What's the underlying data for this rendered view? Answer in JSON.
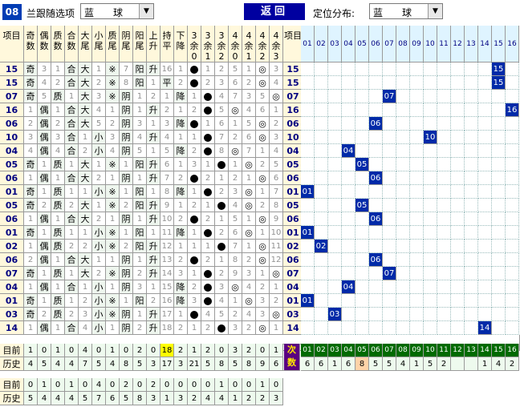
{
  "toolbar": {
    "badge": "08",
    "option_label": "兰跟随选项",
    "option_value": "蓝　　球",
    "return_label": "返回",
    "position_label": "定位分布:",
    "position_value": "蓝　　球"
  },
  "headers": [
    "项目",
    "奇数",
    "偶数",
    "质数",
    "合数",
    "大尾",
    "小尾",
    "质尾",
    "阴尾",
    "阳尾",
    "上升",
    "持平",
    "下降",
    "3余0",
    "3余1",
    "3余2",
    "4余0",
    "4余1",
    "4余2",
    "4余3",
    "项目"
  ],
  "nums": [
    "01",
    "02",
    "03",
    "04",
    "05",
    "06",
    "07",
    "08",
    "09",
    "10",
    "11",
    "12",
    "13",
    "14",
    "15",
    "16"
  ],
  "rows": [
    {
      "n": "15",
      "o": "奇",
      "e": "3",
      "p": "1",
      "h": "合",
      "b": "大",
      "s": "1",
      "pw": "※",
      "yi": "7",
      "ya": "阳",
      "u": "升",
      "f": "16",
      "d": "1",
      "m3": 0,
      "c3": [
        "1",
        "2"
      ],
      "m4": 2,
      "c4": [
        "5",
        "1",
        "3"
      ]
    },
    {
      "n": "15",
      "o": "奇",
      "e": "4",
      "p": "2",
      "h": "合",
      "b": "大",
      "s": "2",
      "pw": "※",
      "yi": "8",
      "ya": "阳",
      "u": "1",
      "f": "平",
      "d": "2",
      "m3": 0,
      "c3": [
        "2",
        "3"
      ],
      "m4": 2,
      "c4": [
        "6",
        "2",
        "4"
      ]
    },
    {
      "n": "07",
      "o": "奇",
      "e": "5",
      "p": "质",
      "h": "1",
      "b": "大",
      "s": "3",
      "pw": "※",
      "yi": "阴",
      "ya": "1",
      "u": "2",
      "f": "1",
      "d": "降",
      "m3": 1,
      "c3": [
        "1",
        "4"
      ],
      "m4": 3,
      "c4": [
        "7",
        "3",
        "5"
      ]
    },
    {
      "n": "16",
      "o": "1",
      "e": "偶",
      "p": "1",
      "h": "合",
      "b": "大",
      "s": "4",
      "pw": "1",
      "yi": "阴",
      "ya": "1",
      "u": "升",
      "f": "2",
      "d": "1",
      "m3": 1,
      "c3": [
        "2",
        "5"
      ],
      "m4": 0,
      "c4": [
        "4",
        "6",
        "1"
      ]
    },
    {
      "n": "06",
      "o": "2",
      "e": "偶",
      "p": "2",
      "h": "合",
      "b": "大",
      "s": "5",
      "pw": "2",
      "yi": "阴",
      "ya": "3",
      "u": "1",
      "f": "3",
      "d": "降",
      "m3": 0,
      "c3": [
        "1",
        "6"
      ],
      "m4": 2,
      "c4": [
        "1",
        "5",
        "2"
      ]
    },
    {
      "n": "10",
      "o": "3",
      "e": "偶",
      "p": "3",
      "h": "合",
      "b": "1",
      "s": "小",
      "pw": "3",
      "yi": "阴",
      "ya": "4",
      "u": "升",
      "f": "4",
      "d": "1",
      "m3": 1,
      "c3": [
        "1",
        "7"
      ],
      "m4": 2,
      "c4": [
        "2",
        "6",
        "3"
      ]
    },
    {
      "n": "04",
      "o": "4",
      "e": "偶",
      "p": "4",
      "h": "合",
      "b": "2",
      "s": "小",
      "pw": "4",
      "yi": "阴",
      "ya": "5",
      "u": "1",
      "f": "5",
      "d": "降",
      "m3": 1,
      "c3": [
        "2",
        "8"
      ],
      "m4": 0,
      "c4": [
        "7",
        "1",
        "4"
      ]
    },
    {
      "n": "05",
      "o": "奇",
      "e": "1",
      "p": "质",
      "h": "1",
      "b": "大",
      "s": "1",
      "pw": "※",
      "yi": "1",
      "ya": "阳",
      "u": "升",
      "f": "6",
      "d": "1",
      "m3": 2,
      "c3": [
        "3",
        "1"
      ],
      "m4": 1,
      "c4": [
        "1",
        "2",
        "5"
      ]
    },
    {
      "n": "06",
      "o": "1",
      "e": "偶",
      "p": "1",
      "h": "合",
      "b": "大",
      "s": "2",
      "pw": "1",
      "yi": "阴",
      "ya": "1",
      "u": "升",
      "f": "7",
      "d": "2",
      "m3": 0,
      "c3": [
        "2",
        "1"
      ],
      "m4": 2,
      "c4": [
        "2",
        "1",
        "6"
      ]
    },
    {
      "n": "01",
      "o": "奇",
      "e": "1",
      "p": "质",
      "h": "1",
      "b": "1",
      "s": "小",
      "pw": "※",
      "yi": "1",
      "ya": "阳",
      "u": "1",
      "f": "8",
      "d": "降",
      "m3": 1,
      "c3": [
        "1",
        "2"
      ],
      "m4": 1,
      "c4": [
        "3",
        "1",
        "7"
      ]
    },
    {
      "n": "05",
      "o": "奇",
      "e": "2",
      "p": "质",
      "h": "2",
      "b": "大",
      "s": "1",
      "pw": "※",
      "yi": "2",
      "ya": "阳",
      "u": "升",
      "f": "9",
      "d": "1",
      "m3": 2,
      "c3": [
        "2",
        "1"
      ],
      "m4": 1,
      "c4": [
        "4",
        "2",
        "8"
      ]
    },
    {
      "n": "06",
      "o": "1",
      "e": "偶",
      "p": "1",
      "h": "合",
      "b": "大",
      "s": "2",
      "pw": "1",
      "yi": "阴",
      "ya": "1",
      "u": "升",
      "f": "10",
      "d": "2",
      "m3": 0,
      "c3": [
        "2",
        "1"
      ],
      "m4": 2,
      "c4": [
        "5",
        "1",
        "9"
      ]
    },
    {
      "n": "01",
      "o": "奇",
      "e": "1",
      "p": "质",
      "h": "1",
      "b": "1",
      "s": "小",
      "pw": "※",
      "yi": "1",
      "ya": "阳",
      "u": "1",
      "f": "11",
      "d": "降",
      "m3": 1,
      "c3": [
        "1",
        "2"
      ],
      "m4": 1,
      "c4": [
        "6",
        "1",
        "10"
      ]
    },
    {
      "n": "02",
      "o": "1",
      "e": "偶",
      "p": "质",
      "h": "2",
      "b": "2",
      "s": "小",
      "pw": "※",
      "yi": "2",
      "ya": "阳",
      "u": "升",
      "f": "12",
      "d": "1",
      "m3": 2,
      "c3": [
        "1",
        "1"
      ],
      "m4": 2,
      "c4": [
        "7",
        "1",
        "11"
      ]
    },
    {
      "n": "06",
      "o": "2",
      "e": "偶",
      "p": "1",
      "h": "合",
      "b": "大",
      "s": "1",
      "pw": "1",
      "yi": "阴",
      "ya": "1",
      "u": "升",
      "f": "13",
      "d": "2",
      "m3": 0,
      "c3": [
        "2",
        "1"
      ],
      "m4": 2,
      "c4": [
        "8",
        "2",
        "12"
      ]
    },
    {
      "n": "07",
      "o": "奇",
      "e": "1",
      "p": "质",
      "h": "1",
      "b": "大",
      "s": "2",
      "pw": "※",
      "yi": "阴",
      "ya": "2",
      "u": "升",
      "f": "14",
      "d": "3",
      "m3": 1,
      "c3": [
        "1",
        "2"
      ],
      "m4": 3,
      "c4": [
        "9",
        "3",
        "1"
      ]
    },
    {
      "n": "04",
      "o": "1",
      "e": "偶",
      "p": "1",
      "h": "合",
      "b": "1",
      "s": "小",
      "pw": "1",
      "yi": "阴",
      "ya": "3",
      "u": "1",
      "f": "15",
      "d": "降",
      "m3": 1,
      "c3": [
        "2",
        "3"
      ],
      "m4": 0,
      "c4": [
        "4",
        "2",
        "1"
      ]
    },
    {
      "n": "01",
      "o": "奇",
      "e": "1",
      "p": "质",
      "h": "1",
      "b": "2",
      "s": "小",
      "pw": "※",
      "yi": "1",
      "ya": "阳",
      "u": "2",
      "f": "16",
      "d": "降",
      "m3": 1,
      "c3": [
        "3",
        "4"
      ],
      "m4": 1,
      "c4": [
        "1",
        "3",
        "2"
      ]
    },
    {
      "n": "03",
      "o": "奇",
      "e": "2",
      "p": "质",
      "h": "2",
      "b": "3",
      "s": "小",
      "pw": "※",
      "yi": "阴",
      "ya": "1",
      "u": "升",
      "f": "17",
      "d": "1",
      "m3": 0,
      "c3": [
        "4",
        "5"
      ],
      "m4": 3,
      "c4": [
        "2",
        "4",
        "3"
      ]
    },
    {
      "n": "14",
      "o": "1",
      "e": "偶",
      "p": "1",
      "h": "合",
      "b": "4",
      "s": "小",
      "pw": "1",
      "yi": "阴",
      "ya": "2",
      "u": "升",
      "f": "18",
      "d": "2",
      "m3": 2,
      "c3": [
        "1",
        "2"
      ],
      "m4": 2,
      "c4": [
        "3",
        "2",
        "1"
      ]
    }
  ],
  "stats": {
    "label1": "目前",
    "label2": "历史",
    "current": [
      "1",
      "0",
      "1",
      "0",
      "4",
      "0",
      "1",
      "0",
      "2",
      "0",
      "18",
      "2",
      "1",
      "2",
      "0",
      "3",
      "2",
      "0",
      "1"
    ],
    "history": [
      "4",
      "5",
      "4",
      "4",
      "7",
      "5",
      "4",
      "8",
      "5",
      "3",
      "17",
      "3",
      "21",
      "5",
      "8",
      "5",
      "8",
      "9",
      "6",
      "12"
    ],
    "cishu": "次数",
    "num_current": [
      "6",
      "6",
      "1",
      "6",
      "8",
      "5",
      "5",
      "4",
      "1",
      "5",
      "2",
      "",
      "",
      "1",
      "4",
      "2"
    ]
  },
  "stats2": {
    "label1": "目前",
    "label2": "历史",
    "current": [
      "0",
      "1",
      "0",
      "1",
      "0",
      "4",
      "0",
      "2",
      "0",
      "2",
      "0",
      "0",
      "0",
      "0",
      "1",
      "0",
      "0",
      "1",
      "0"
    ],
    "history": [
      "5",
      "4",
      "4",
      "4",
      "5",
      "7",
      "6",
      "5",
      "8",
      "3",
      "1",
      "3",
      "2",
      "4",
      "4",
      "1",
      "2",
      "2",
      "3"
    ]
  }
}
